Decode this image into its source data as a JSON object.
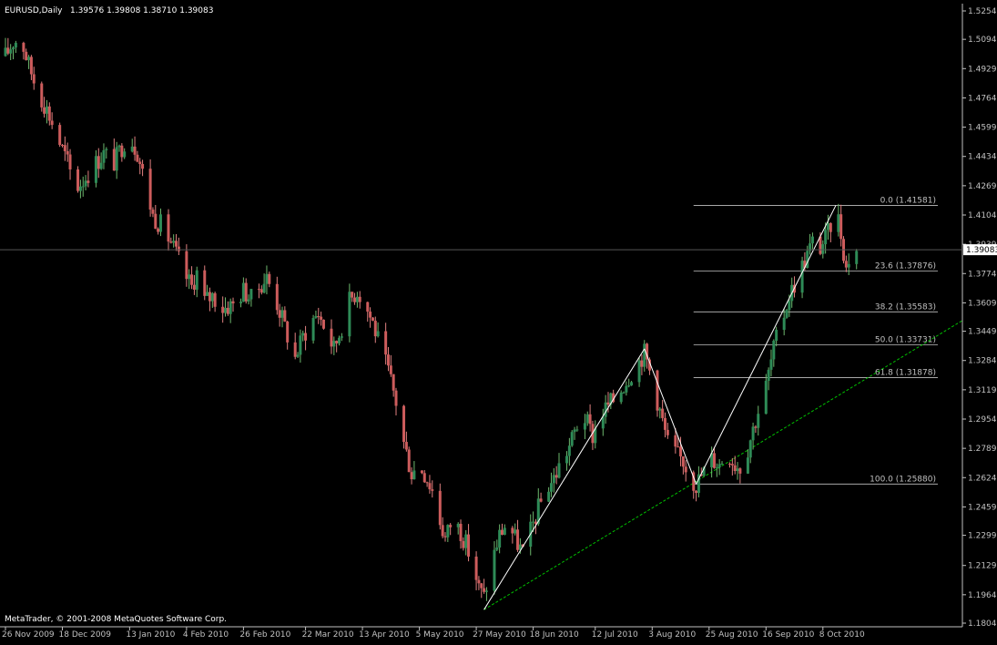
{
  "header": {
    "symbol_label": "EURUSD,Daily",
    "ohlc": "1.39576 1.39808 1.38710 1.39083"
  },
  "footer": {
    "copyright": "MetaTrader, © 2001-2008 MetaQuotes Software Corp."
  },
  "colors": {
    "background": "#000000",
    "axis": "#c0c0c0",
    "bull_fill": "#2e8b57",
    "bull_wick": "#6db86d",
    "bear_fill": "#cd5c5c",
    "bear_wick": "#e08080",
    "fib": "#c0c0c0",
    "trendline": "#ffffff",
    "support_line": "#00c000",
    "price_tag_bg": "#ffffff",
    "price_tag_fg": "#000000"
  },
  "chart_data": {
    "type": "candlestick",
    "symbol": "EURUSD",
    "timeframe": "Daily",
    "ylim": [
      1.1804,
      1.5254
    ],
    "current_price": 1.39083,
    "current_price_label": "1.39083",
    "y_ticks": [
      "1.52540",
      "1.50940",
      "1.49290",
      "1.47640",
      "1.45990",
      "1.44340",
      "1.42690",
      "1.41040",
      "1.39390",
      "1.37740",
      "1.36090",
      "1.34490",
      "1.32840",
      "1.31190",
      "1.29540",
      "1.27890",
      "1.26240",
      "1.24590",
      "1.22990",
      "1.21290",
      "1.19640",
      "1.18040"
    ],
    "x_ticks": [
      {
        "label": "26 Nov 2009",
        "day": 0
      },
      {
        "label": "18 Dec 2009",
        "day": 22
      },
      {
        "label": "13 Jan 2010",
        "day": 48
      },
      {
        "label": "4 Feb 2010",
        "day": 70
      },
      {
        "label": "26 Feb 2010",
        "day": 92
      },
      {
        "label": "22 Mar 2010",
        "day": 116
      },
      {
        "label": "13 Apr 2010",
        "day": 138
      },
      {
        "label": "5 May 2010",
        "day": 160
      },
      {
        "label": "27 May 2010",
        "day": 182
      },
      {
        "label": "18 Jun 2010",
        "day": 204
      },
      {
        "label": "12 Jul 2010",
        "day": 228
      },
      {
        "label": "3 Aug 2010",
        "day": 250
      },
      {
        "label": "25 Aug 2010",
        "day": 272
      },
      {
        "label": "16 Sep 2010",
        "day": 294
      },
      {
        "label": "8 Oct 2010",
        "day": 316
      }
    ],
    "close_path": [
      [
        0,
        1.5
      ],
      [
        3,
        1.508
      ],
      [
        6,
        1.51
      ],
      [
        9,
        1.495
      ],
      [
        12,
        1.482
      ],
      [
        16,
        1.47
      ],
      [
        20,
        1.455
      ],
      [
        24,
        1.44
      ],
      [
        27,
        1.425
      ],
      [
        30,
        1.43
      ],
      [
        34,
        1.438
      ],
      [
        38,
        1.445
      ],
      [
        42,
        1.44
      ],
      [
        46,
        1.452
      ],
      [
        48,
        1.455
      ],
      [
        51,
        1.446
      ],
      [
        54,
        1.428
      ],
      [
        57,
        1.41
      ],
      [
        60,
        1.405
      ],
      [
        64,
        1.395
      ],
      [
        67,
        1.385
      ],
      [
        70,
        1.375
      ],
      [
        72,
        1.37
      ],
      [
        74,
        1.378
      ],
      [
        77,
        1.362
      ],
      [
        80,
        1.365
      ],
      [
        84,
        1.358
      ],
      [
        88,
        1.36
      ],
      [
        92,
        1.368
      ],
      [
        95,
        1.363
      ],
      [
        99,
        1.372
      ],
      [
        101,
        1.375
      ],
      [
        104,
        1.365
      ],
      [
        107,
        1.352
      ],
      [
        110,
        1.338
      ],
      [
        112,
        1.33
      ],
      [
        115,
        1.342
      ],
      [
        118,
        1.35
      ],
      [
        121,
        1.355
      ],
      [
        124,
        1.345
      ],
      [
        127,
        1.335
      ],
      [
        130,
        1.348
      ],
      [
        133,
        1.362
      ],
      [
        136,
        1.368
      ],
      [
        139,
        1.36
      ],
      [
        142,
        1.35
      ],
      [
        145,
        1.335
      ],
      [
        148,
        1.322
      ],
      [
        151,
        1.305
      ],
      [
        154,
        1.282
      ],
      [
        157,
        1.265
      ],
      [
        160,
        1.27
      ],
      [
        163,
        1.262
      ],
      [
        166,
        1.252
      ],
      [
        168,
        1.238
      ],
      [
        170,
        1.228
      ],
      [
        173,
        1.24
      ],
      [
        176,
        1.232
      ],
      [
        178,
        1.225
      ],
      [
        181,
        1.212
      ],
      [
        183,
        1.2
      ],
      [
        185,
        1.195
      ],
      [
        188,
        1.215
      ],
      [
        191,
        1.23
      ],
      [
        194,
        1.238
      ],
      [
        197,
        1.228
      ],
      [
        200,
        1.22
      ],
      [
        203,
        1.232
      ],
      [
        206,
        1.245
      ],
      [
        209,
        1.256
      ],
      [
        212,
        1.262
      ],
      [
        215,
        1.272
      ],
      [
        218,
        1.28
      ],
      [
        221,
        1.292
      ],
      [
        224,
        1.296
      ],
      [
        227,
        1.286
      ],
      [
        230,
        1.298
      ],
      [
        233,
        1.303
      ],
      [
        236,
        1.308
      ],
      [
        239,
        1.315
      ],
      [
        242,
        1.322
      ],
      [
        245,
        1.328
      ],
      [
        247,
        1.333
      ],
      [
        250,
        1.318
      ],
      [
        253,
        1.3
      ],
      [
        256,
        1.282
      ],
      [
        259,
        1.276
      ],
      [
        262,
        1.272
      ],
      [
        265,
        1.262
      ],
      [
        267,
        1.2588
      ],
      [
        270,
        1.266
      ],
      [
        273,
        1.273
      ],
      [
        276,
        1.27
      ],
      [
        279,
        1.278
      ],
      [
        282,
        1.27
      ],
      [
        285,
        1.268
      ],
      [
        288,
        1.285
      ],
      [
        291,
        1.3
      ],
      [
        294,
        1.314
      ],
      [
        297,
        1.335
      ],
      [
        300,
        1.35
      ],
      [
        303,
        1.365
      ],
      [
        306,
        1.375
      ],
      [
        309,
        1.385
      ],
      [
        312,
        1.395
      ],
      [
        315,
        1.392
      ],
      [
        318,
        1.4
      ],
      [
        321,
        1.41581
      ],
      [
        323,
        1.4
      ],
      [
        325,
        1.38
      ],
      [
        327,
        1.392
      ],
      [
        329,
        1.39083
      ]
    ],
    "fibonacci": {
      "low": 1.2588,
      "high": 1.41581,
      "from_day": 266,
      "levels": [
        {
          "label": "0.0 (1.41581)",
          "price": 1.41581
        },
        {
          "label": "23.6 (1.37876)",
          "price": 1.37876
        },
        {
          "label": "38.2 (1.35583)",
          "price": 1.35583
        },
        {
          "label": "50.0 (1.33731)",
          "price": 1.33731
        },
        {
          "label": "61.8 (1.31878)",
          "price": 1.31878
        },
        {
          "label": "100.0 (1.25880)",
          "price": 1.2588
        }
      ]
    },
    "trend_lines": [
      {
        "from": {
          "day": 185,
          "price": 1.188
        },
        "to": {
          "day": 247,
          "price": 1.335
        }
      },
      {
        "from": {
          "day": 247,
          "price": 1.335
        },
        "to": {
          "day": 267,
          "price": 1.2588
        }
      },
      {
        "from": {
          "day": 267,
          "price": 1.2588
        },
        "to": {
          "day": 321,
          "price": 1.41581
        }
      }
    ],
    "support_line": {
      "from": {
        "day": 185,
        "price": 1.188
      },
      "to": {
        "day": 370,
        "price": 1.351
      }
    }
  }
}
